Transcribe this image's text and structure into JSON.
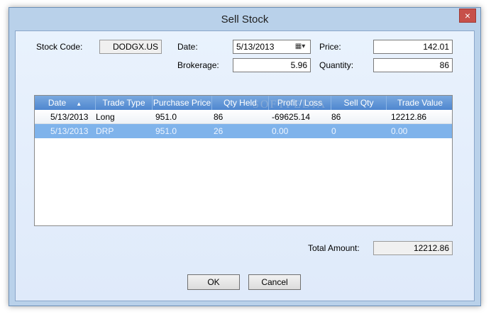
{
  "window": {
    "title": "Sell Stock",
    "close_glyph": "×"
  },
  "form": {
    "stock_code_label": "Stock Code:",
    "stock_code_value": "DODGX.US",
    "date_label": "Date:",
    "date_value": "5/13/2013",
    "price_label": "Price:",
    "price_value": "142.01",
    "brokerage_label": "Brokerage:",
    "brokerage_value": "5.96",
    "quantity_label": "Quantity:",
    "quantity_value": "86"
  },
  "grid": {
    "columns": [
      "Date",
      "Trade Type",
      "Purchase Price",
      "Qty Held",
      "Profit / Loss",
      "Sell Qty",
      "Trade Value"
    ],
    "rows": [
      [
        "5/13/2013",
        "Long",
        "951.0",
        "86",
        "-69625.14",
        "86",
        "12212.86"
      ],
      [
        "5/13/2013",
        "DRP",
        "951.0",
        "26",
        "0.00",
        "0",
        "0.00"
      ]
    ]
  },
  "totals": {
    "total_amount_label": "Total Amount:",
    "total_amount_value": "12212.86"
  },
  "buttons": {
    "ok": "OK",
    "cancel": "Cancel"
  },
  "watermark_text": "SOFTPEDIA",
  "icons": {
    "date_dropdown": "calendar-dropdown-icon",
    "sort": "sort-ascending-icon",
    "close": "close-icon"
  },
  "colors": {
    "header": "#4e86cf",
    "selected_row": "#7fb3eb",
    "close_button": "#c7504a"
  }
}
